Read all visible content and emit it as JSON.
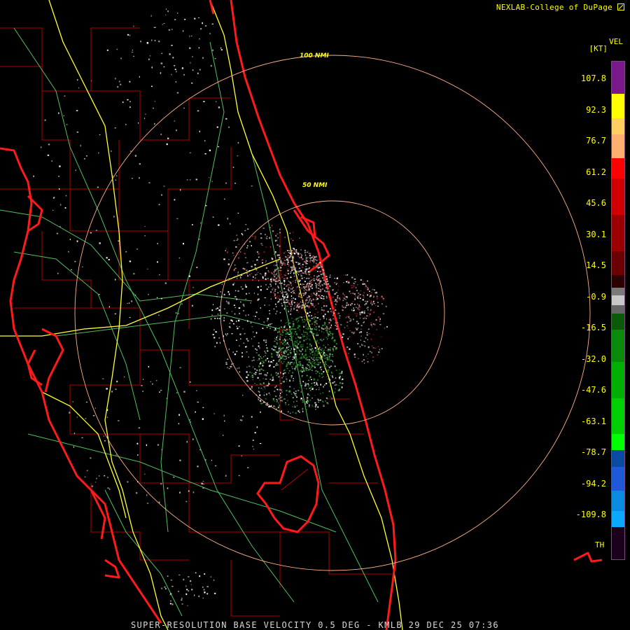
{
  "header": {
    "credit": "NEXLAB-College of DuPage",
    "logo_icon": "cod-logo-icon"
  },
  "legend": {
    "product": "VEL",
    "units": "[KT]",
    "ticks": [
      "107.8",
      "92.3",
      "76.7",
      "61.2",
      "45.6",
      "30.1",
      "14.5",
      "-0.9",
      "-16.5",
      "-32.0",
      "-47.6",
      "-63.1",
      "-78.7",
      "-94.2",
      "-109.8"
    ],
    "threshold_label": "TH",
    "colors": {
      "purple": "#7a1a8a",
      "yellow": "#ffff00",
      "peach": "#ffb070",
      "red": "#ff0000",
      "dark_red": "#6a0000",
      "gray": "#c8c8c8",
      "dark_green": "#0a5a0a",
      "green": "#00d000",
      "blue": "#1e5ad8",
      "cyan": "#0aa8ff"
    }
  },
  "rings": [
    {
      "label": "50 NMI"
    },
    {
      "label": "100 NMI"
    }
  ],
  "footer": {
    "caption": "SUPER-RESOLUTION BASE VELOCITY 0.5 DEG - KMLB 29 DEC 25 07:36"
  },
  "map_colors": {
    "coast": "#ff1a1a",
    "county": "#c00000",
    "highway": "#ffff33",
    "road": "#55cc66",
    "ring": "#ffb088"
  }
}
